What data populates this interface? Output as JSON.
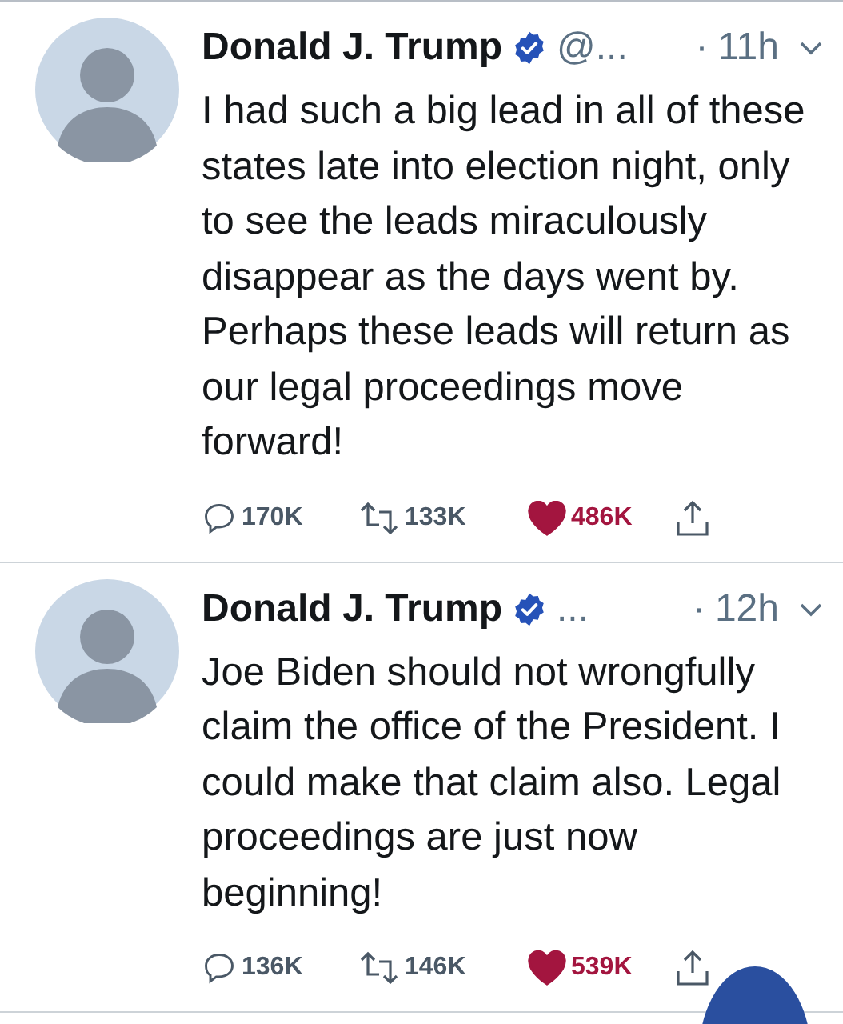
{
  "tweets": [
    {
      "name": "Donald J. Trump",
      "verified": true,
      "handle": "@...",
      "separator": "·",
      "time": "11h",
      "text": "I had such a big lead in all of these states late into election night, only to see the leads miraculously disappear as the days went by. Perhaps these leads will return as our legal proceedings move forward!",
      "replies": "170K",
      "retweets": "133K",
      "likes": "486K",
      "liked": true
    },
    {
      "name": "Donald J. Trump",
      "verified": true,
      "handle": "...",
      "separator": "·",
      "time": "12h",
      "text": "Joe Biden should not wrongfully claim the office of the President. I could make that claim also. Legal proceedings are just now beginning!",
      "replies": "136K",
      "retweets": "146K",
      "likes": "539K",
      "liked": true
    }
  ],
  "compose_button": {
    "kind": "fab"
  }
}
